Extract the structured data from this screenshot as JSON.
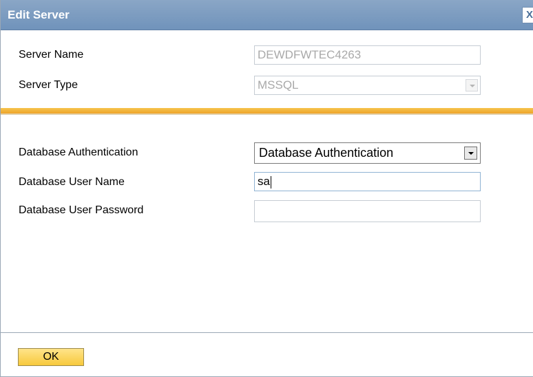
{
  "dialog": {
    "title": "Edit Server",
    "close_label": "X"
  },
  "server": {
    "name_label": "Server Name",
    "name_value": "DEWDFWTEC4263",
    "type_label": "Server Type",
    "type_value": "MSSQL"
  },
  "database": {
    "auth_label": "Database Authentication",
    "auth_value": "Database Authentication",
    "user_label": "Database User Name",
    "user_value": "sa",
    "password_label": "Database User Password",
    "password_value": ""
  },
  "footer": {
    "ok_label": "OK"
  },
  "colors": {
    "title_bar": "#7f9dc2",
    "divider": "#f0ac2e",
    "ok_button": "#f7c93c"
  }
}
